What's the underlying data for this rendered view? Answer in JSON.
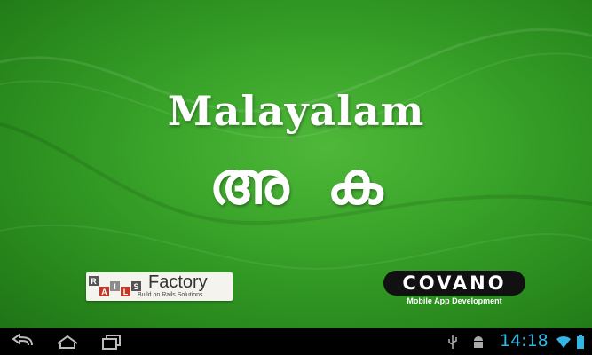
{
  "app": {
    "title": "Malayalam",
    "letters": [
      "അ",
      "ക"
    ]
  },
  "logos": {
    "rails_factory": {
      "blocks": [
        "R",
        "A",
        "I",
        "L",
        "S"
      ],
      "word": "Factory",
      "tagline": "Build on Rails Solutions"
    },
    "covano": {
      "name": "COVANO",
      "tagline": "Mobile App Development"
    }
  },
  "navbar": {
    "buttons": [
      "back-icon",
      "home-icon",
      "recent-apps-icon"
    ],
    "status_icons": [
      "usb-icon",
      "android-debug-icon",
      "wifi-icon",
      "battery-icon"
    ],
    "time": "14:18"
  },
  "colors": {
    "background": "#3aa52a",
    "clock": "#33b5e5",
    "block_red": "#c0392b",
    "block_dark": "#555555",
    "block_gray": "#8c8c8c"
  }
}
